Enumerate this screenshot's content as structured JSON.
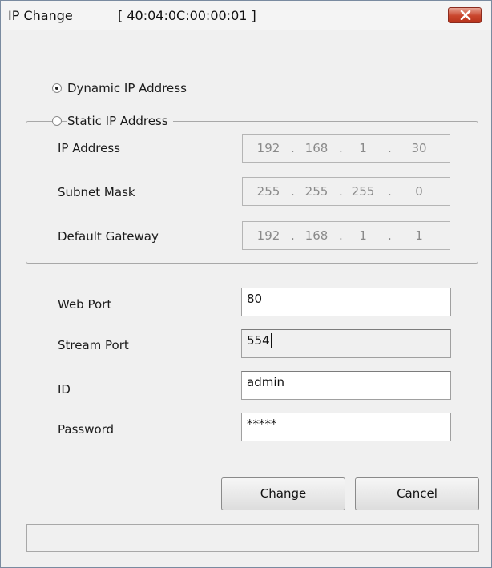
{
  "window": {
    "title": "IP Change",
    "mac_address": "[ 40:04:0C:00:00:01 ]",
    "close_label": "X"
  },
  "ip_mode": {
    "dynamic_label": "Dynamic IP Address",
    "static_label": "Static IP Address",
    "selected": "Dynamic IP Address"
  },
  "static_group": {
    "ip_address": {
      "label": "IP Address",
      "octets": [
        "192",
        "168",
        "1",
        "30"
      ]
    },
    "subnet_mask": {
      "label": "Subnet Mask",
      "octets": [
        "255",
        "255",
        "255",
        "0"
      ]
    },
    "default_gateway": {
      "label": "Default Gateway",
      "octets": [
        "192",
        "168",
        "1",
        "1"
      ]
    },
    "separator": "."
  },
  "settings": {
    "web_port": {
      "label": "Web Port",
      "value": "80"
    },
    "stream_port": {
      "label": "Stream Port",
      "value": "554"
    },
    "id": {
      "label": "ID",
      "value": "admin"
    },
    "password": {
      "label": "Password",
      "value": "*****"
    }
  },
  "buttons": {
    "change": "Change",
    "cancel": "Cancel"
  },
  "status": {
    "text": ""
  }
}
